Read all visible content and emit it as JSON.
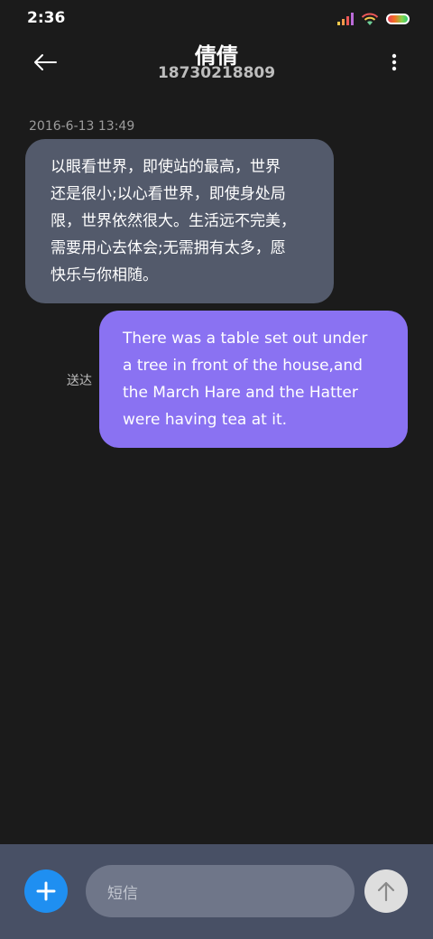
{
  "status_bar": {
    "time": "2:36"
  },
  "header": {
    "contact_name": "倩倩",
    "phone_number": "18730218809"
  },
  "messages": [
    {
      "direction": "incoming",
      "timestamp": "2016-6-13 13:49",
      "lines": [
        "以眼看世界，即使站的最高，世界",
        "还是很小;以心看世界，即使身处局",
        "限，世界依然很大。生活远不完美，",
        "需要用心去体会;无需拥有太多，愿",
        "快乐与你相随。"
      ]
    },
    {
      "direction": "outgoing",
      "status": "送达",
      "lines": [
        "There was a table set out under",
        "a tree in front of the house,and",
        "the March Hare and the Hatter",
        "were having tea at it."
      ]
    }
  ],
  "composer": {
    "placeholder": "短信"
  },
  "colors": {
    "background": "#1b1b1b",
    "incoming_bubble": "#535a6b",
    "outgoing_bubble": "#8a72f2",
    "composer_bar": "#485065",
    "add_button": "#1f8ff1"
  },
  "icons": {
    "back": "arrow-left-icon",
    "menu": "more-vertical-icon",
    "add": "plus-icon",
    "send": "arrow-up-icon"
  }
}
